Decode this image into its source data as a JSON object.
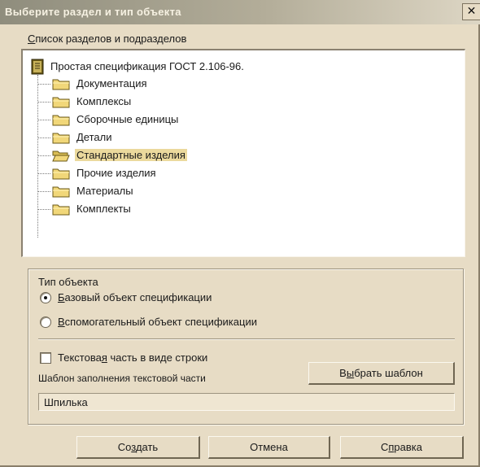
{
  "dialog": {
    "title": "Выберите раздел и тип объекта",
    "close_glyph": "✕"
  },
  "tree": {
    "label_prefix": "С",
    "label_rest": "писок разделов и подразделов",
    "root": "Простая спецификация ГОСТ 2.106-96.",
    "items": [
      {
        "label": "Документация",
        "selected": false
      },
      {
        "label": "Комплексы",
        "selected": false
      },
      {
        "label": "Сборочные единицы",
        "selected": false
      },
      {
        "label": "Детали",
        "selected": false
      },
      {
        "label": "Стандартные изделия",
        "selected": true
      },
      {
        "label": "Прочие изделия",
        "selected": false
      },
      {
        "label": "Материалы",
        "selected": false
      },
      {
        "label": "Комплекты",
        "selected": false
      }
    ]
  },
  "object_type": {
    "title": "Тип объекта",
    "base_prefix": "Б",
    "base_rest": "азовый объект спецификации",
    "aux_prefix": "В",
    "aux_rest": "спомогательный объект спецификации",
    "selected": "base"
  },
  "text_part": {
    "checkbox_pre": "Текстова",
    "checkbox_u": "я",
    "checkbox_post": " часть в виде строки",
    "checked": false,
    "template_label": "Шаблон заполнения текстовой части",
    "choose_pre": "В",
    "choose_u": "ы",
    "choose_post": "брать шаблон",
    "value": "Шпилька"
  },
  "buttons": {
    "create_pre": "Со",
    "create_u": "з",
    "create_post": "дать",
    "cancel": "Отмена",
    "help_pre": "С",
    "help_u": "п",
    "help_post": "равка"
  },
  "colors": {
    "dialog_bg": "#e7dcc5",
    "selection": "#ebd99d",
    "folder": "#f1d779"
  }
}
